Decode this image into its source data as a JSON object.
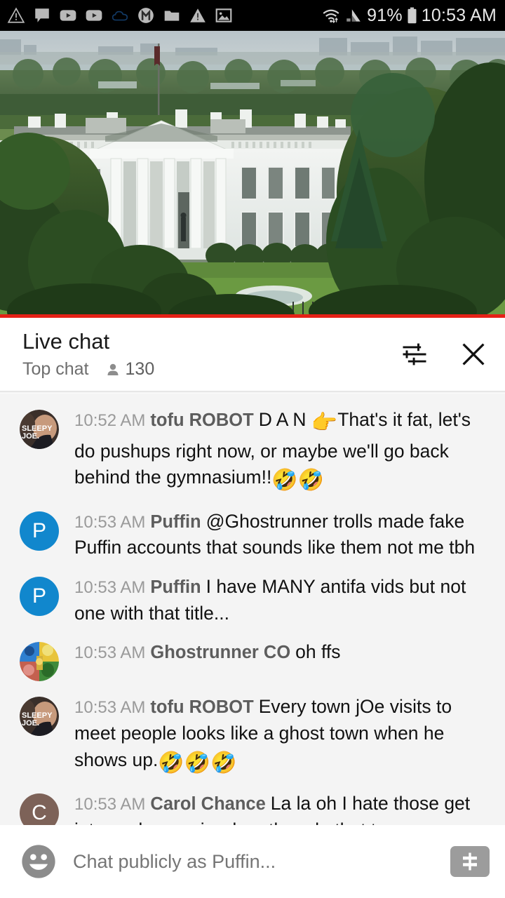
{
  "status_bar": {
    "icons": [
      "warning-triangle-icon",
      "chat-bubble-icon",
      "youtube-play-icon",
      "youtube-play-icon",
      "cloud-outline-icon",
      "m-circle-icon",
      "folder-icon",
      "warning-triangle-icon",
      "image-icon"
    ],
    "wifi_icon": "wifi-updown-icon",
    "signal_icon": "signal-bars-icon",
    "battery_percent": "91%",
    "battery_icon": "battery-icon",
    "time": "10:53 AM"
  },
  "video": {
    "progress_color": "#e62117",
    "alt": "white-house-north-facade-live-stream"
  },
  "chat_header": {
    "title": "Live chat",
    "subtitle": "Top chat",
    "viewer_icon": "person-icon",
    "viewer_count": "130",
    "settings_icon": "tune-sliders-icon",
    "close_icon": "close-x-icon"
  },
  "messages": [
    {
      "time": "10:52 AM",
      "author": "tofu ROBOT",
      "segments": [
        {
          "type": "text",
          "value": "D A N "
        },
        {
          "type": "emoji",
          "value": "👉"
        },
        {
          "type": "text",
          "value": "That's it fat, let's do pushups right now, or maybe we'll go back behind the gymnasium!!"
        },
        {
          "type": "emoji",
          "value": "🤣🤣"
        }
      ],
      "avatar": {
        "kind": "photo",
        "style": "sleepy-joe",
        "label": "SLEEPY JOE",
        "color": "#6b5346"
      }
    },
    {
      "time": "10:53 AM",
      "author": "Puffin",
      "segments": [
        {
          "type": "text",
          "value": "@Ghostrunner trolls made fake Puffin accounts that sounds like them not me tbh"
        }
      ],
      "avatar": {
        "kind": "letter",
        "letter": "P",
        "color": "#1187cd"
      }
    },
    {
      "time": "10:53 AM",
      "author": "Puffin",
      "segments": [
        {
          "type": "text",
          "value": "I have MANY antifa vids but not one with that title..."
        }
      ],
      "avatar": {
        "kind": "letter",
        "letter": "P",
        "color": "#1187cd"
      }
    },
    {
      "time": "10:53 AM",
      "author": "Ghostrunner CO",
      "segments": [
        {
          "type": "text",
          "value": "oh ffs"
        }
      ],
      "avatar": {
        "kind": "collage",
        "color": "#c8992c"
      }
    },
    {
      "time": "10:53 AM",
      "author": "tofu ROBOT",
      "segments": [
        {
          "type": "text",
          "value": "Every town jOe visits to meet people looks like a ghost town when he shows up."
        },
        {
          "type": "emoji",
          "value": "🤣🤣🤣"
        }
      ],
      "avatar": {
        "kind": "photo",
        "style": "sleepy-joe",
        "label": "SLEEPY JOE",
        "color": "#6b5346"
      }
    },
    {
      "time": "10:53 AM",
      "author": "Carol Chance",
      "segments": [
        {
          "type": "text",
          "value": "La la oh I hate those get into such a panic when they do that to you"
        }
      ],
      "avatar": {
        "kind": "letter",
        "letter": "C",
        "color": "#7d6258"
      }
    }
  ],
  "input_bar": {
    "emoji_icon": "emoji-smiley-icon",
    "placeholder": "Chat publicly as Puffin...",
    "value": "",
    "superchat_icon": "dollar-superchat-icon"
  }
}
